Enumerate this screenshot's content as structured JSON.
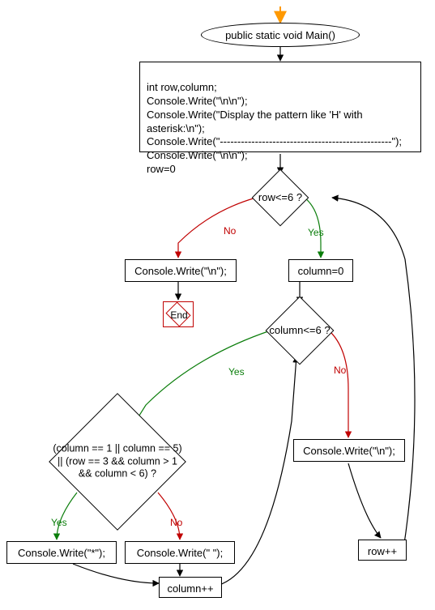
{
  "chart_data": {
    "type": "flowchart",
    "nodes": [
      {
        "id": "n_start",
        "kind": "terminator",
        "text": "public static void Main()"
      },
      {
        "id": "n_init",
        "kind": "process",
        "text": "int row,column;\nConsole.Write(\"\\n\\n\");\nConsole.Write(\"Display the pattern like 'H' with asterisk:\\n\");\nConsole.Write(\"-------------------------------------------------\");\nConsole.Write(\"\\n\\n\");\nrow=0"
      },
      {
        "id": "n_d_row",
        "kind": "decision",
        "text": "row<=6 ?"
      },
      {
        "id": "n_nl_row",
        "kind": "process",
        "text": "Console.Write(\"\\n\");"
      },
      {
        "id": "n_end",
        "kind": "terminator",
        "text": "End"
      },
      {
        "id": "n_col0",
        "kind": "process",
        "text": "column=0"
      },
      {
        "id": "n_d_col",
        "kind": "decision",
        "text": "column<=6 ?"
      },
      {
        "id": "n_d_cond",
        "kind": "decision",
        "text": "(column == 1 || column == 5) || (row == 3 && column > 1 && column < 6) ?"
      },
      {
        "id": "n_star",
        "kind": "process",
        "text": "Console.Write(\"*\");"
      },
      {
        "id": "n_space",
        "kind": "process",
        "text": "Console.Write(\" \");"
      },
      {
        "id": "n_colpp",
        "kind": "process",
        "text": "column++"
      },
      {
        "id": "n_nl_col",
        "kind": "process",
        "text": "Console.Write(\"\\n\");"
      },
      {
        "id": "n_rowpp",
        "kind": "process",
        "text": "row++"
      }
    ],
    "edges": [
      {
        "from": "entry",
        "to": "n_start"
      },
      {
        "from": "n_start",
        "to": "n_init"
      },
      {
        "from": "n_init",
        "to": "n_d_row"
      },
      {
        "from": "n_d_row",
        "to": "n_nl_row",
        "label": "No"
      },
      {
        "from": "n_nl_row",
        "to": "n_end"
      },
      {
        "from": "n_d_row",
        "to": "n_col0",
        "label": "Yes"
      },
      {
        "from": "n_col0",
        "to": "n_d_col"
      },
      {
        "from": "n_d_col",
        "to": "n_d_cond",
        "label": "Yes"
      },
      {
        "from": "n_d_cond",
        "to": "n_star",
        "label": "Yes"
      },
      {
        "from": "n_d_cond",
        "to": "n_space",
        "label": "No"
      },
      {
        "from": "n_star",
        "to": "n_colpp"
      },
      {
        "from": "n_space",
        "to": "n_colpp"
      },
      {
        "from": "n_colpp",
        "to": "n_d_col"
      },
      {
        "from": "n_d_col",
        "to": "n_nl_col",
        "label": "No"
      },
      {
        "from": "n_nl_col",
        "to": "n_rowpp"
      },
      {
        "from": "n_rowpp",
        "to": "n_d_row"
      }
    ]
  },
  "labels": {
    "yes": "Yes",
    "no": "No"
  }
}
